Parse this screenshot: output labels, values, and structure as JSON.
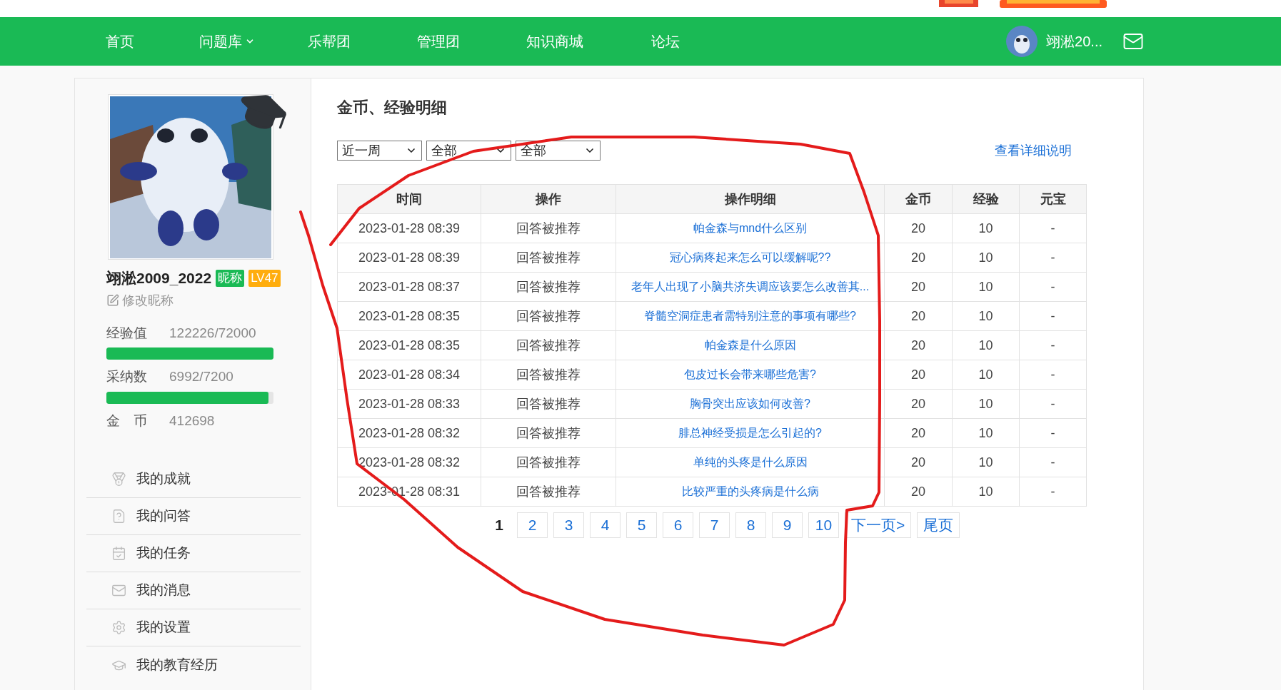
{
  "nav": {
    "items": [
      {
        "label": "首页",
        "dropdown": false
      },
      {
        "label": "问题库",
        "dropdown": true
      },
      {
        "label": "乐帮团",
        "dropdown": false
      },
      {
        "label": "管理团",
        "dropdown": false
      },
      {
        "label": "知识商城",
        "dropdown": false
      },
      {
        "label": "论坛",
        "dropdown": false
      }
    ],
    "user": "翊淞20..."
  },
  "profile": {
    "name": "翊淞2009_2022",
    "badges": [
      {
        "text": "昵称",
        "color": "#1aba55"
      },
      {
        "text": "LV47",
        "color": "#ffad0d"
      }
    ],
    "edit": "修改昵称",
    "stats": [
      {
        "label": "经验值",
        "value": "122226/72000",
        "level": 1.0
      },
      {
        "label": "采纳数",
        "value": "6992/7200",
        "level": 0.971
      },
      {
        "label": "金　币",
        "value": "412698"
      }
    ]
  },
  "menu": [
    {
      "label": "我的成就",
      "kind": "medal"
    },
    {
      "label": "我的问答",
      "kind": "question"
    },
    {
      "label": "我的任务",
      "kind": "task"
    },
    {
      "label": "我的消息",
      "kind": "mail"
    },
    {
      "label": "我的设置",
      "kind": "settings"
    },
    {
      "label": "我的教育经历",
      "kind": "education"
    }
  ],
  "main": {
    "title": "金币、经验明细",
    "filters": [
      "近一周",
      "全部",
      "全部"
    ],
    "help_link": "查看详细说明",
    "table": {
      "columns": [
        "时间",
        "操作",
        "操作明细",
        "金币",
        "经验",
        "元宝"
      ],
      "rows": [
        [
          "2023-01-28 08:39",
          "回答被推荐",
          "帕金森与mnd什么区别",
          "20",
          "10",
          "-"
        ],
        [
          "2023-01-28 08:39",
          "回答被推荐",
          "冠心病疼起来怎么可以缓解呢??",
          "20",
          "10",
          "-"
        ],
        [
          "2023-01-28 08:37",
          "回答被推荐",
          "老年人出现了小脑共济失调应该要怎么改善其...",
          "20",
          "10",
          "-"
        ],
        [
          "2023-01-28 08:35",
          "回答被推荐",
          "脊髓空洞症患者需特别注意的事项有哪些?",
          "20",
          "10",
          "-"
        ],
        [
          "2023-01-28 08:35",
          "回答被推荐",
          "帕金森是什么原因",
          "20",
          "10",
          "-"
        ],
        [
          "2023-01-28 08:34",
          "回答被推荐",
          "包皮过长会带来哪些危害?",
          "20",
          "10",
          "-"
        ],
        [
          "2023-01-28 08:33",
          "回答被推荐",
          "胸骨突出应该如何改善?",
          "20",
          "10",
          "-"
        ],
        [
          "2023-01-28 08:32",
          "回答被推荐",
          "腓总神经受损是怎么引起的?",
          "20",
          "10",
          "-"
        ],
        [
          "2023-01-28 08:32",
          "回答被推荐",
          "单纯的头疼是什么原因",
          "20",
          "10",
          "-"
        ],
        [
          "2023-01-28 08:31",
          "回答被推荐",
          "比较严重的头疼病是什么病",
          "20",
          "10",
          "-"
        ]
      ]
    },
    "pagination": [
      {
        "label": "1",
        "selected": true
      },
      {
        "label": "2",
        "selected": false
      },
      {
        "label": "3",
        "selected": false
      },
      {
        "label": "4",
        "selected": false
      },
      {
        "label": "5",
        "selected": false
      },
      {
        "label": "6",
        "selected": false
      },
      {
        "label": "7",
        "selected": false
      },
      {
        "label": "8",
        "selected": false
      },
      {
        "label": "9",
        "selected": false
      },
      {
        "label": "10",
        "selected": false
      },
      {
        "label": "下一页>",
        "selected": false
      },
      {
        "label": "尾页",
        "selected": false
      }
    ]
  }
}
